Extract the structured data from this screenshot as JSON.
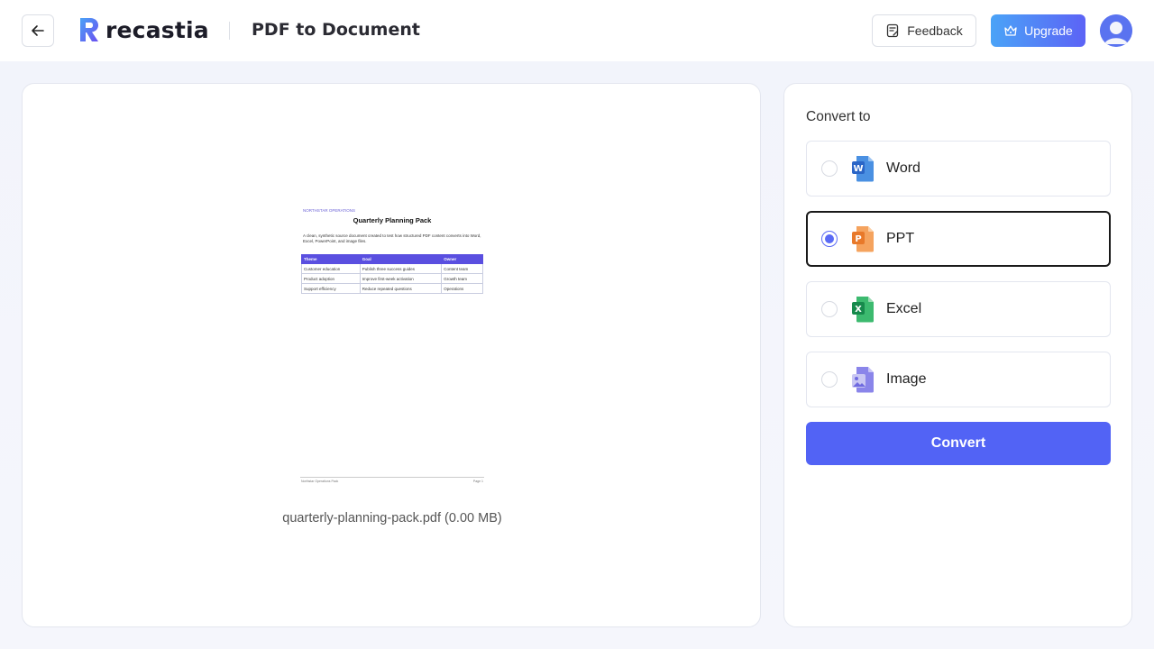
{
  "header": {
    "brand": "recastia",
    "title": "PDF to Document",
    "feedback_label": "Feedback",
    "upgrade_label": "Upgrade"
  },
  "preview": {
    "pdf": {
      "small_label": "NORTHSTAR OPERATIONS",
      "title": "Quarterly Planning Pack",
      "description": "A clean, synthetic source document created to test how structured PDF content converts into Word, Excel, PowerPoint, and image files.",
      "table": {
        "headers": [
          "Theme",
          "Goal",
          "Owner"
        ],
        "rows": [
          [
            "Customer education",
            "Publish three success guides",
            "Content team"
          ],
          [
            "Product adoption",
            "Improve first-week activation",
            "Growth team"
          ],
          [
            "Support efficiency",
            "Reduce repeated questions",
            "Operations"
          ]
        ]
      },
      "footer_left": "Northstar Operations Pack",
      "footer_right": "Page 1"
    },
    "file_caption": "quarterly-planning-pack.pdf (0.00 MB)"
  },
  "convert": {
    "label": "Convert to",
    "options": [
      {
        "label": "Word",
        "icon": "word-icon",
        "selected": false
      },
      {
        "label": "PPT",
        "icon": "ppt-icon",
        "selected": true
      },
      {
        "label": "Excel",
        "icon": "excel-icon",
        "selected": false
      },
      {
        "label": "Image",
        "icon": "image-icon",
        "selected": false
      }
    ],
    "button_label": "Convert"
  },
  "colors": {
    "accent": "#5263f5",
    "upgrade_gradient_start": "#4aa3f7",
    "upgrade_gradient_end": "#5c63f6",
    "word": "#2b7cd3",
    "ppt": "#f08a3c",
    "excel": "#21a366",
    "image": "#6f6ae0"
  }
}
